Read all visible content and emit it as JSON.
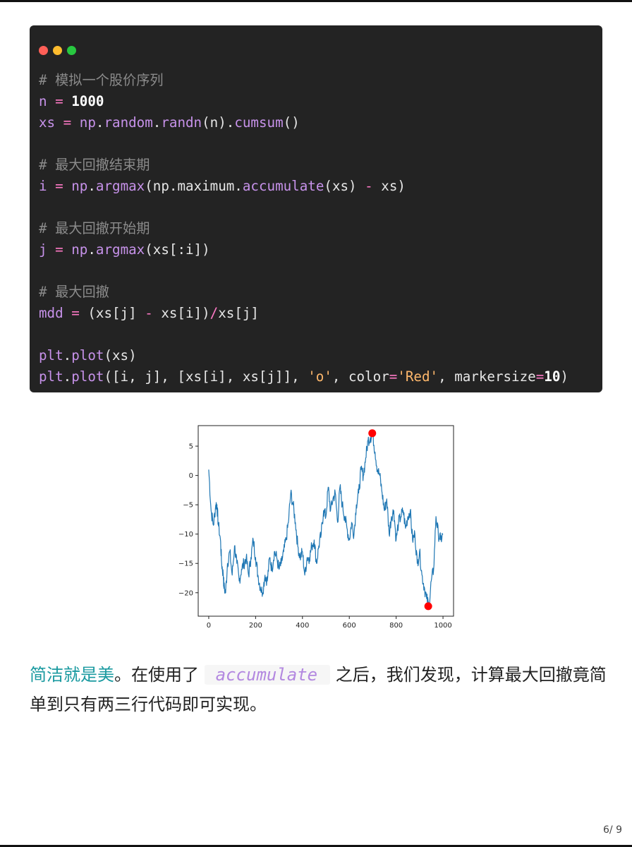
{
  "code_block": {
    "lines": [
      [
        {
          "t": "# 模拟一个股价序列",
          "c": "cm"
        }
      ],
      [
        {
          "t": "n",
          "c": "var"
        },
        {
          "t": " ",
          "c": "plain"
        },
        {
          "t": "=",
          "c": "op"
        },
        {
          "t": " ",
          "c": "plain"
        },
        {
          "t": "1000",
          "c": "num"
        }
      ],
      [
        {
          "t": "xs",
          "c": "var"
        },
        {
          "t": " ",
          "c": "plain"
        },
        {
          "t": "=",
          "c": "op"
        },
        {
          "t": " ",
          "c": "plain"
        },
        {
          "t": "np",
          "c": "fn"
        },
        {
          "t": ".",
          "c": "plain"
        },
        {
          "t": "random",
          "c": "fn"
        },
        {
          "t": ".",
          "c": "plain"
        },
        {
          "t": "randn",
          "c": "fn"
        },
        {
          "t": "(n).",
          "c": "plain"
        },
        {
          "t": "cumsum",
          "c": "fn"
        },
        {
          "t": "()",
          "c": "plain"
        }
      ],
      [],
      [
        {
          "t": "# 最大回撤结束期",
          "c": "cm"
        }
      ],
      [
        {
          "t": "i",
          "c": "var"
        },
        {
          "t": " ",
          "c": "plain"
        },
        {
          "t": "=",
          "c": "op"
        },
        {
          "t": " ",
          "c": "plain"
        },
        {
          "t": "np",
          "c": "fn"
        },
        {
          "t": ".",
          "c": "plain"
        },
        {
          "t": "argmax",
          "c": "fn"
        },
        {
          "t": "(np.maximum.",
          "c": "plain"
        },
        {
          "t": "accumulate",
          "c": "fn"
        },
        {
          "t": "(xs) ",
          "c": "plain"
        },
        {
          "t": "-",
          "c": "op"
        },
        {
          "t": " xs)",
          "c": "plain"
        }
      ],
      [],
      [
        {
          "t": "# 最大回撤开始期",
          "c": "cm"
        }
      ],
      [
        {
          "t": "j",
          "c": "var"
        },
        {
          "t": " ",
          "c": "plain"
        },
        {
          "t": "=",
          "c": "op"
        },
        {
          "t": " ",
          "c": "plain"
        },
        {
          "t": "np",
          "c": "fn"
        },
        {
          "t": ".",
          "c": "plain"
        },
        {
          "t": "argmax",
          "c": "fn"
        },
        {
          "t": "(xs[:i])",
          "c": "plain"
        }
      ],
      [],
      [
        {
          "t": "# 最大回撤",
          "c": "cm"
        }
      ],
      [
        {
          "t": "mdd",
          "c": "var"
        },
        {
          "t": " ",
          "c": "plain"
        },
        {
          "t": "=",
          "c": "op"
        },
        {
          "t": " ",
          "c": "plain"
        },
        {
          "t": "(xs[j] ",
          "c": "plain"
        },
        {
          "t": "-",
          "c": "op"
        },
        {
          "t": " xs[i])",
          "c": "plain"
        },
        {
          "t": "/",
          "c": "op"
        },
        {
          "t": "xs[j]",
          "c": "plain"
        }
      ],
      [],
      [
        {
          "t": "plt",
          "c": "fn"
        },
        {
          "t": ".",
          "c": "plain"
        },
        {
          "t": "plot",
          "c": "fn"
        },
        {
          "t": "(xs)",
          "c": "plain"
        }
      ],
      [
        {
          "t": "plt",
          "c": "fn"
        },
        {
          "t": ".",
          "c": "plain"
        },
        {
          "t": "plot",
          "c": "fn"
        },
        {
          "t": "([i, j], [xs[i], xs[j]], ",
          "c": "plain"
        },
        {
          "t": "'o'",
          "c": "str"
        },
        {
          "t": ", color",
          "c": "plain"
        },
        {
          "t": "=",
          "c": "op"
        },
        {
          "t": "'Red'",
          "c": "str"
        },
        {
          "t": ", markersize",
          "c": "plain"
        },
        {
          "t": "=",
          "c": "op"
        },
        {
          "t": "10",
          "c": "num"
        },
        {
          "t": ")",
          "c": "plain"
        }
      ]
    ]
  },
  "chart_data": {
    "type": "line",
    "xlim": [
      -45,
      1045
    ],
    "ylim": [
      -24,
      8.5
    ],
    "xticks": [
      0,
      200,
      400,
      600,
      800,
      1000
    ],
    "yticks": [
      5,
      0,
      -5,
      -10,
      -15,
      -20
    ],
    "series": [
      {
        "color": "#1f77b4",
        "x": [
          0,
          10,
          20,
          30,
          35,
          40,
          50,
          55,
          62,
          65,
          72,
          80,
          90,
          100,
          110,
          120,
          130,
          140,
          150,
          160,
          170,
          180,
          190,
          200,
          210,
          220,
          230,
          240,
          250,
          260,
          270,
          280,
          290,
          300,
          310,
          320,
          330,
          340,
          350,
          360,
          370,
          380,
          390,
          400,
          410,
          420,
          430,
          440,
          450,
          460,
          470,
          480,
          490,
          500,
          510,
          520,
          530,
          540,
          550,
          560,
          570,
          580,
          590,
          600,
          610,
          620,
          630,
          640,
          650,
          660,
          670,
          680,
          690,
          700,
          710,
          720,
          730,
          740,
          750,
          760,
          770,
          780,
          790,
          800,
          810,
          820,
          830,
          840,
          850,
          860,
          870,
          880,
          890,
          900,
          910,
          920,
          930,
          940,
          950,
          960,
          970,
          980,
          990,
          1000
        ],
        "y": [
          1,
          -6,
          -8.5,
          -5,
          -5,
          -8,
          -11,
          -15,
          -17,
          -19,
          -20,
          -15,
          -13,
          -17,
          -12,
          -15,
          -18,
          -16,
          -15,
          -14,
          -17,
          -14,
          -11,
          -14,
          -17,
          -19,
          -20,
          -17,
          -18,
          -14,
          -16,
          -13,
          -14,
          -16,
          -15,
          -13,
          -11,
          -8,
          -3,
          -5,
          -8,
          -12,
          -14,
          -13,
          -17,
          -14,
          -14,
          -12,
          -11,
          -15,
          -12,
          -10,
          -6,
          -7,
          -2,
          -6,
          -4,
          -3,
          -8,
          -2,
          -5,
          -7,
          -9,
          -11,
          -8,
          -10,
          -5,
          -3,
          1,
          0,
          3,
          6,
          6.5,
          7,
          4,
          1,
          0,
          -3,
          -6,
          -4,
          -10,
          -7,
          -6,
          -11,
          -8,
          -7,
          -6,
          -9,
          -7,
          -6,
          -11,
          -10,
          -15,
          -13,
          -17,
          -19,
          -21,
          -22.3,
          -18,
          -16,
          -7,
          -10,
          -11,
          -10
        ]
      },
      {
        "color": "#ff0000",
        "x": [
          937,
          698
        ],
        "y": [
          -22.3,
          7.2
        ],
        "marker": "o"
      }
    ]
  },
  "paragraph": {
    "highlight": "简洁就是美",
    "text1": "。在使用了",
    "code": "accumulate",
    "text2": "之后，我们发现，计算最大回撤竟简单到只有两三行代码即可实现。"
  },
  "page_number": "6/ 9"
}
